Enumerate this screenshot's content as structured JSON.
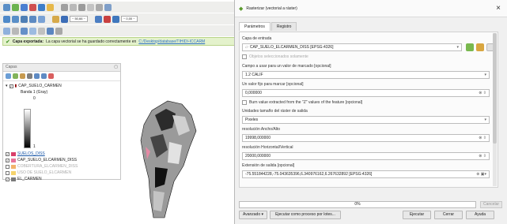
{
  "toolbar": {
    "combo1": "~ 50,66 ~",
    "combo2": "~ 0,00 ~",
    "icons": [
      "save-icon",
      "open-icon",
      "digitize-icon",
      "zoom-icon",
      "pan-icon",
      "select-icon",
      "identify-icon",
      "measure-icon",
      "attribute-table-icon",
      "python-icon",
      "help-icon"
    ]
  },
  "message": {
    "bold": "Capa exportada:",
    "text": " La capa vectorial se ha guardado correctamente en",
    "link": " C:/Desktop/database/TIHIDI-ICCARM"
  },
  "layers_panel": {
    "title": "Capas",
    "items": [
      {
        "label": "CAP_SUELO_CARMEN",
        "checked": true
      },
      {
        "label": "Banda 1 (Gray)"
      },
      {
        "label": "0"
      },
      {
        "label": "1"
      },
      {
        "label": "SUELOS_DISS",
        "checked": true
      },
      {
        "label": "CAP_SUELO_ELCARMEN_DISS",
        "checked": true
      },
      {
        "label": "COBERTURA_ELCARMEN_DISS",
        "checked": false
      },
      {
        "label": "USO DE SUELO_ELCARMEN",
        "checked": false
      },
      {
        "label": "EL_CARMEN",
        "checked": true
      }
    ],
    "colors": {
      "band_item_accent": "#8b0000",
      "diss_swatch": "#e8739a",
      "cob_swatch": "#f2b36b",
      "uso_swatch": "#f5d36c",
      "carmen_swatch": "#7a7a7a"
    }
  },
  "dialog": {
    "title": "Rasterizar (vectorial a ráster)",
    "tabs": [
      "Parámetros",
      "Registro"
    ],
    "input_layer_label": "Capa de entrada",
    "input_layer_value": "CAP_SUELO_ELCARMEN_DISS [EPSG:4326]",
    "selected_only": "Objetos seleccionados solamente",
    "burn_field_label": "Campo a usar para un valor de marcado [opcional]",
    "burn_field_value": "1.2 CALIF",
    "fixed_value_label": "Un valor fijo para marcar [opcional]",
    "fixed_value": "0,000000",
    "burn_z": "Burn value extracted from the \"Z\" values of the feature [opcional]",
    "units_label": "Unidades tamaño del ráster de salida",
    "units_value": "Pixeles",
    "width_label": "resolución Ancho/Alto",
    "width_value": "19998,000000",
    "height_label": "resolución Horizontal/Vertical",
    "height_value": "20000,000000",
    "extent_label": "Extensión de salida [opcional]",
    "extent_value": "-75.551844228,-75.043635396,6.340976162,6.267632892 [EPSG:4326]",
    "progress": "0%",
    "buttons": {
      "advanced": "Avanzado",
      "batch": "Ejecutar como proceso por lotes...",
      "run": "Ejecutar",
      "close": "Cerrar",
      "help": "Ayuda",
      "cancel": "Cancelar"
    }
  }
}
